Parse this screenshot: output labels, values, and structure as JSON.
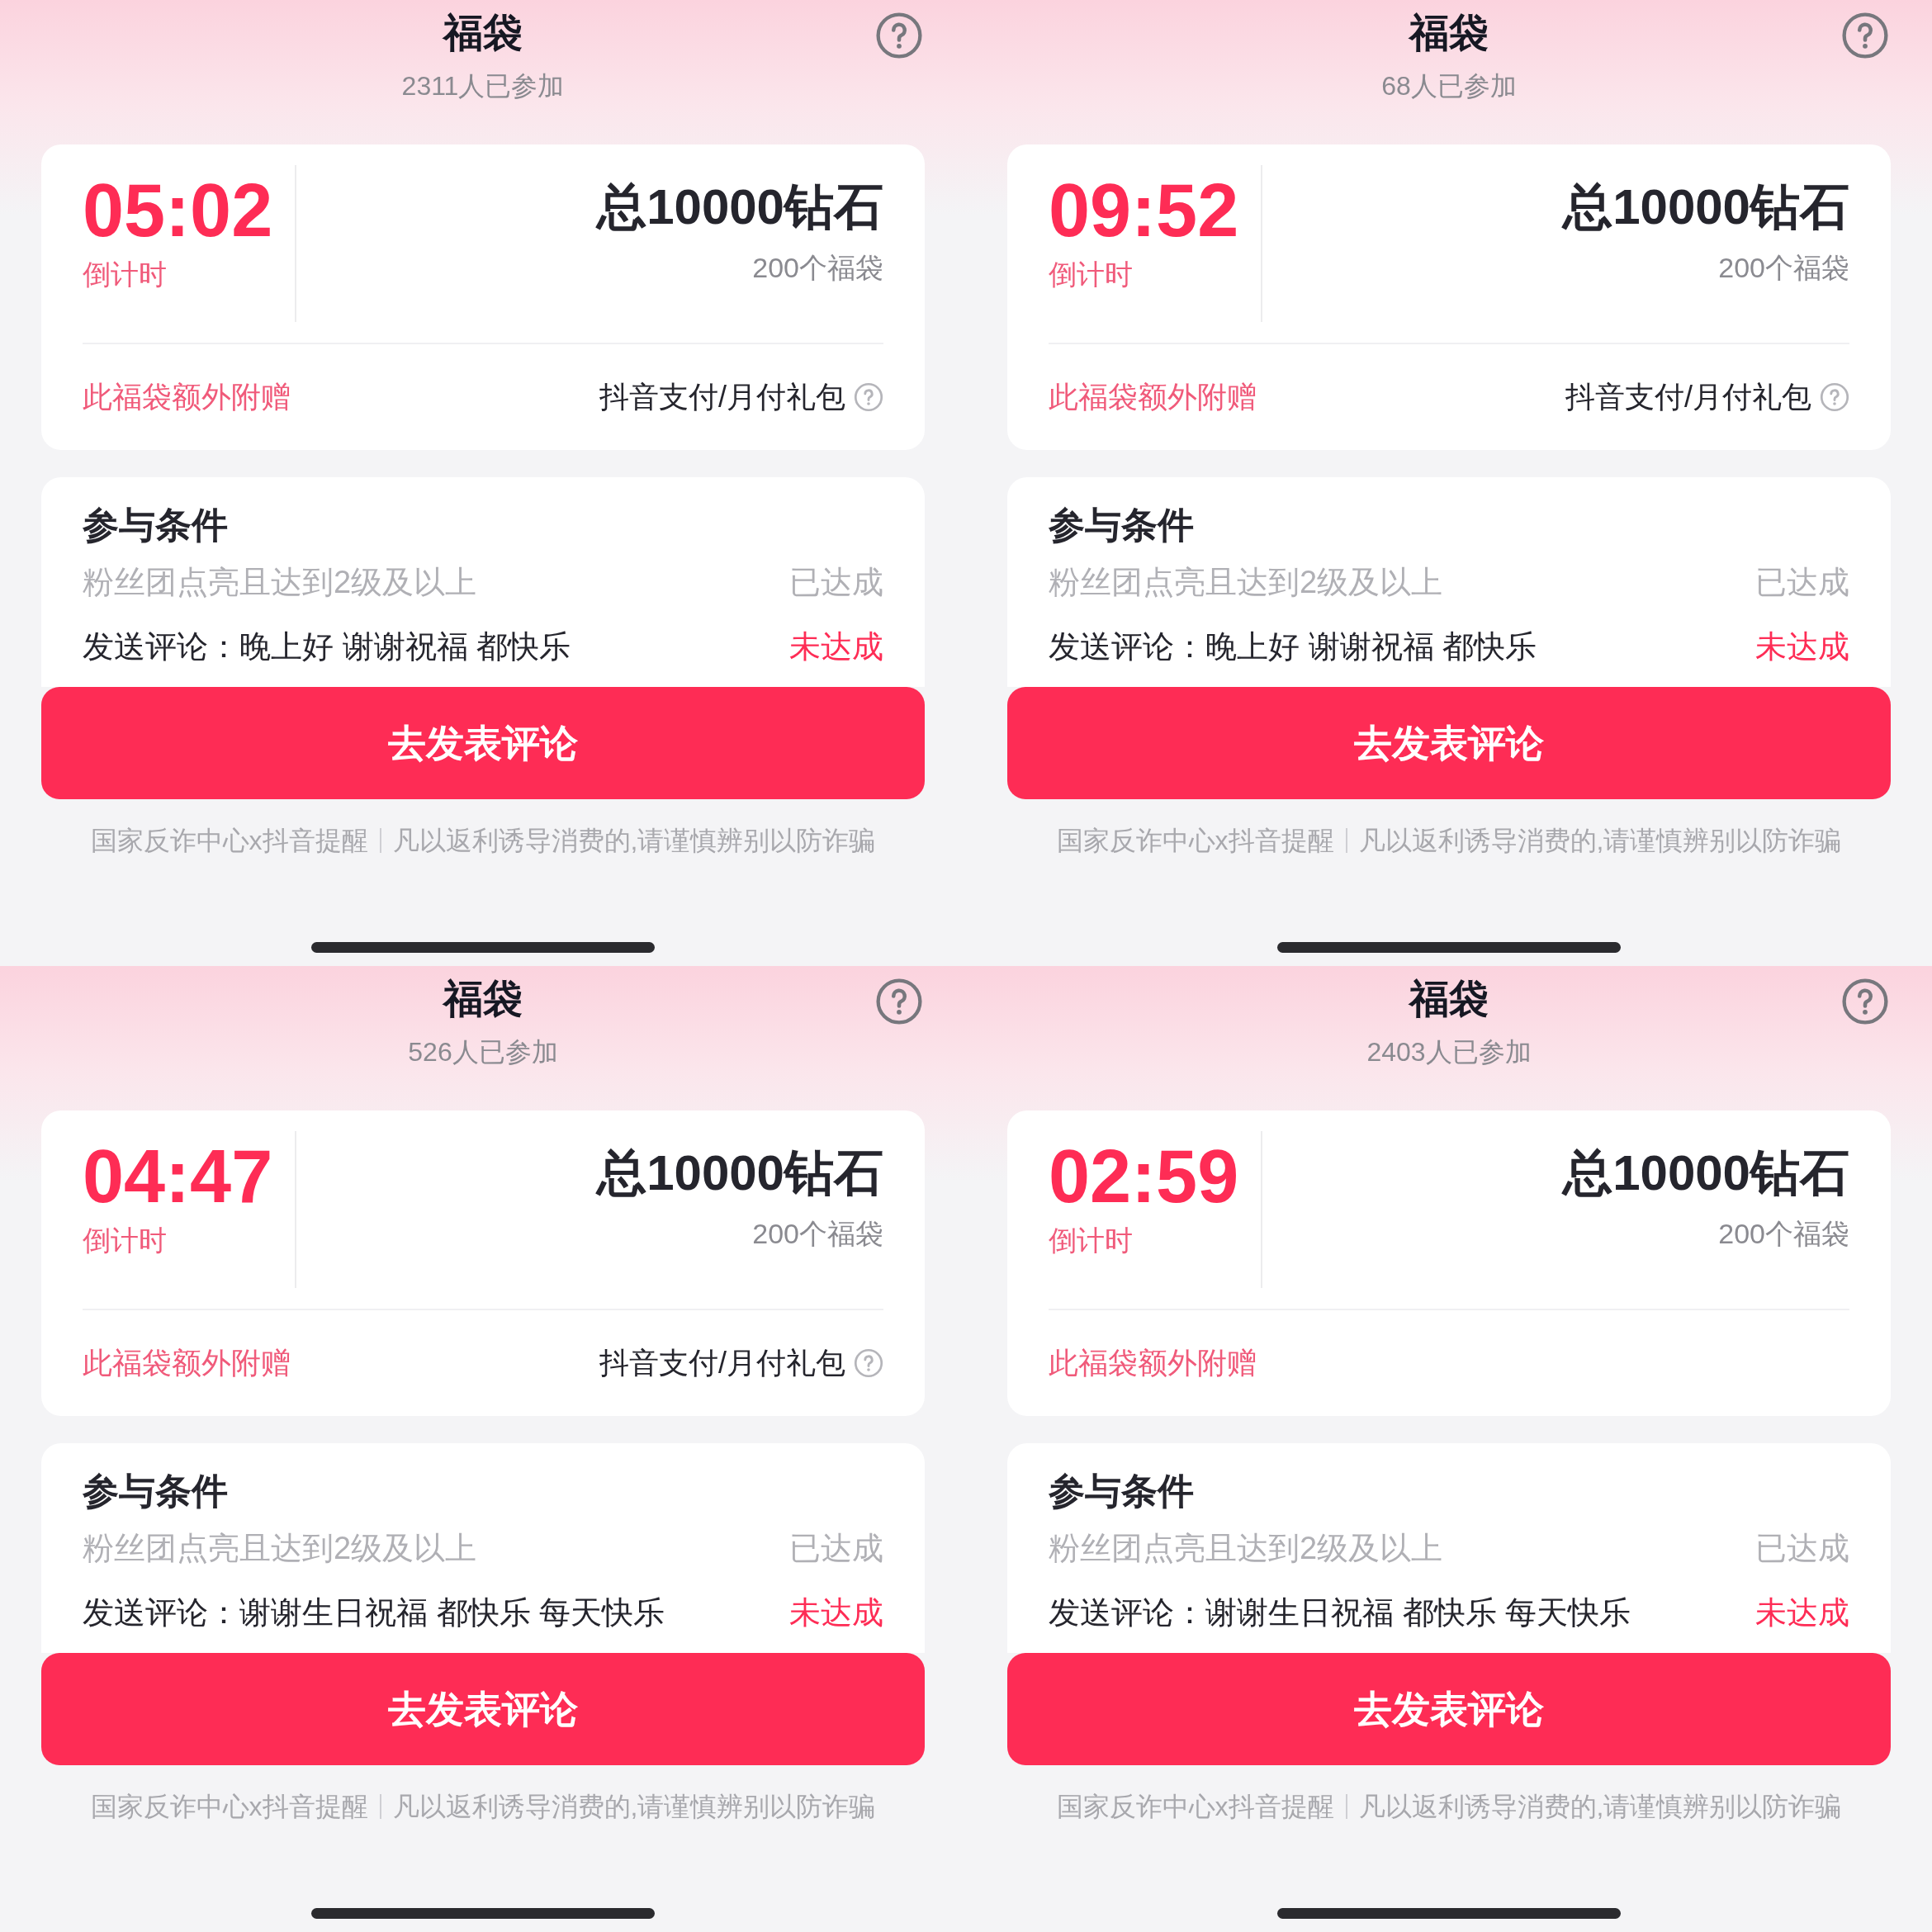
{
  "panels": [
    {
      "title": "福袋",
      "participants": "2311人已参加",
      "countdown": "05:02",
      "countdown_label": "倒计时",
      "total": "总10000钻石",
      "bag_count": "200个福袋",
      "bonus_label": "此福袋额外附赠",
      "gift": "抖音支付/月付礼包",
      "conditions_title": "参与条件",
      "conditions": [
        {
          "text": "粉丝团点亮且达到2级及以上",
          "status": "已达成",
          "achieved": true
        },
        {
          "text": "发送评论：晚上好 谢谢祝福 都快乐",
          "status": "未达成",
          "achieved": false
        }
      ],
      "button": "去发表评论",
      "footer": [
        "国家反诈中心x抖音提醒",
        "凡以返利诱导消费的,请谨慎辨别以防诈骗"
      ]
    },
    {
      "title": "福袋",
      "participants": "68人已参加",
      "countdown": "09:52",
      "countdown_label": "倒计时",
      "total": "总10000钻石",
      "bag_count": "200个福袋",
      "bonus_label": "此福袋额外附赠",
      "gift": "抖音支付/月付礼包",
      "conditions_title": "参与条件",
      "conditions": [
        {
          "text": "粉丝团点亮且达到2级及以上",
          "status": "已达成",
          "achieved": true
        },
        {
          "text": "发送评论：晚上好 谢谢祝福 都快乐",
          "status": "未达成",
          "achieved": false
        }
      ],
      "button": "去发表评论",
      "footer": [
        "国家反诈中心x抖音提醒",
        "凡以返利诱导消费的,请谨慎辨别以防诈骗"
      ]
    },
    {
      "title": "福袋",
      "participants": "526人已参加",
      "countdown": "04:47",
      "countdown_label": "倒计时",
      "total": "总10000钻石",
      "bag_count": "200个福袋",
      "bonus_label": "此福袋额外附赠",
      "gift": "抖音支付/月付礼包",
      "conditions_title": "参与条件",
      "conditions": [
        {
          "text": "粉丝团点亮且达到2级及以上",
          "status": "已达成",
          "achieved": true
        },
        {
          "text": "发送评论：谢谢生日祝福 都快乐 每天快乐",
          "status": "未达成",
          "achieved": false
        }
      ],
      "button": "去发表评论",
      "footer": [
        "国家反诈中心x抖音提醒",
        "凡以返利诱导消费的,请谨慎辨别以防诈骗"
      ]
    },
    {
      "title": "福袋",
      "participants": "2403人已参加",
      "countdown": "02:59",
      "countdown_label": "倒计时",
      "total": "总10000钻石",
      "bag_count": "200个福袋",
      "bonus_label": "此福袋额外附赠",
      "conditions_title": "参与条件",
      "conditions": [
        {
          "text": "粉丝团点亮且达到2级及以上",
          "status": "已达成",
          "achieved": true
        },
        {
          "text": "发送评论：谢谢生日祝福 都快乐 每天快乐",
          "status": "未达成",
          "achieved": false
        }
      ],
      "button": "去发表评论",
      "footer": [
        "国家反诈中心x抖音提醒",
        "凡以返利诱导消费的,请谨慎辨别以防诈骗"
      ]
    }
  ]
}
